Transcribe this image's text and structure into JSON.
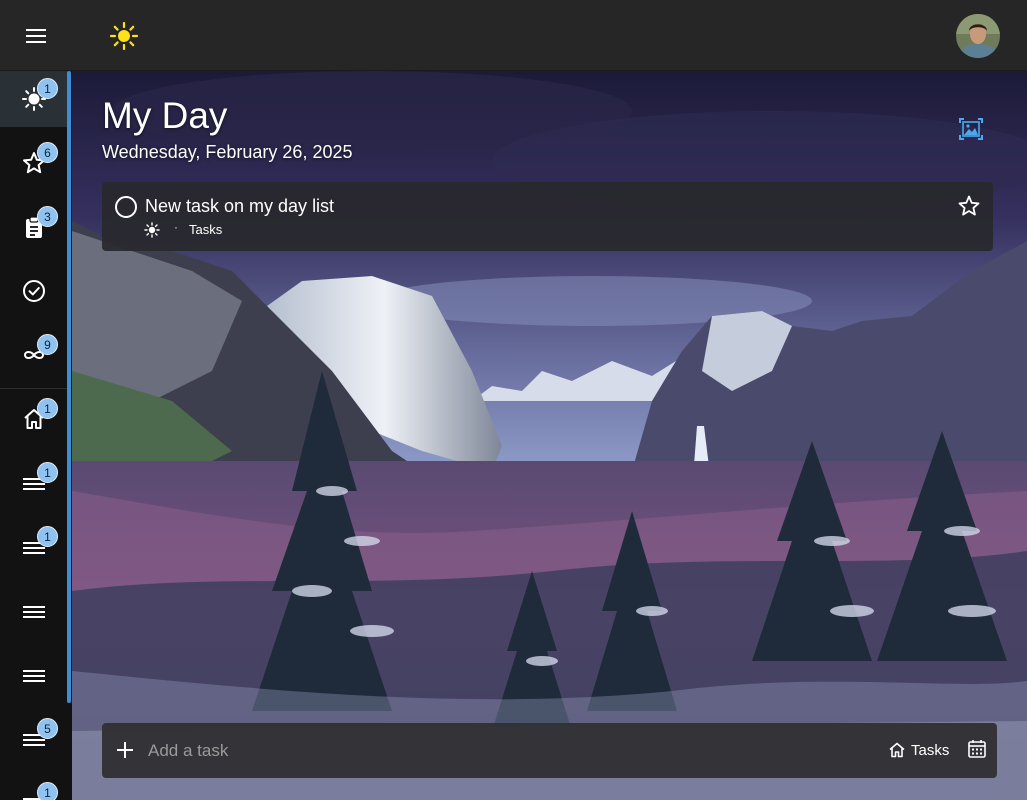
{
  "header": {
    "menu_icon": "hamburger-icon",
    "app_icon": "sun-icon",
    "avatar_icon": "user-avatar"
  },
  "sidebar": {
    "items": [
      {
        "icon": "sun-icon",
        "badge": "1",
        "active": true
      },
      {
        "icon": "star-icon",
        "badge": "6"
      },
      {
        "icon": "clipboard-icon",
        "badge": "3"
      },
      {
        "icon": "check-circle-icon",
        "badge": ""
      },
      {
        "icon": "infinity-icon",
        "badge": "9"
      },
      {
        "icon": "home-icon",
        "badge": "1"
      },
      {
        "icon": "list-icon",
        "badge": "1"
      },
      {
        "icon": "list-icon",
        "badge": "1"
      },
      {
        "icon": "list-icon",
        "badge": ""
      },
      {
        "icon": "list-icon",
        "badge": ""
      },
      {
        "icon": "list-icon",
        "badge": "5"
      },
      {
        "icon": "list-icon",
        "badge": "1"
      }
    ],
    "accent_color": "#3b8fd6",
    "badge_color": "#8fc2f0"
  },
  "main": {
    "title": "My Day",
    "date": "Wednesday, February 26, 2025",
    "background_icon": "image-icon",
    "tasks": [
      {
        "title": "New task on my day list",
        "my_day_icon": "sun-icon",
        "separator": "·",
        "list_name": "Tasks",
        "starred": false
      }
    ]
  },
  "add_task": {
    "placeholder": "Add a task",
    "value": "",
    "list_label": "Tasks",
    "list_icon": "home-icon",
    "due_icon": "calendar-icon"
  }
}
